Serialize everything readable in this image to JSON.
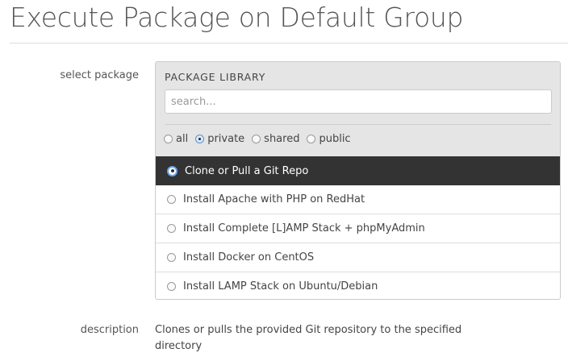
{
  "title": "Execute Package on Default Group",
  "labels": {
    "select_package": "select package",
    "description": "description"
  },
  "library": {
    "heading": "PACKAGE LIBRARY",
    "search_placeholder": "search...",
    "filters": [
      {
        "label": "all",
        "checked": false
      },
      {
        "label": "private",
        "checked": true
      },
      {
        "label": "shared",
        "checked": false
      },
      {
        "label": "public",
        "checked": false
      }
    ],
    "packages": [
      {
        "label": "Clone or Pull a Git Repo",
        "selected": true
      },
      {
        "label": "Install Apache with PHP on RedHat",
        "selected": false
      },
      {
        "label": "Install Complete [L]AMP Stack + phpMyAdmin",
        "selected": false
      },
      {
        "label": "Install Docker on CentOS",
        "selected": false
      },
      {
        "label": "Install LAMP Stack on Ubuntu/Debian",
        "selected": false
      }
    ]
  },
  "description": "Clones or pulls the provided Git repository to the specified directory"
}
